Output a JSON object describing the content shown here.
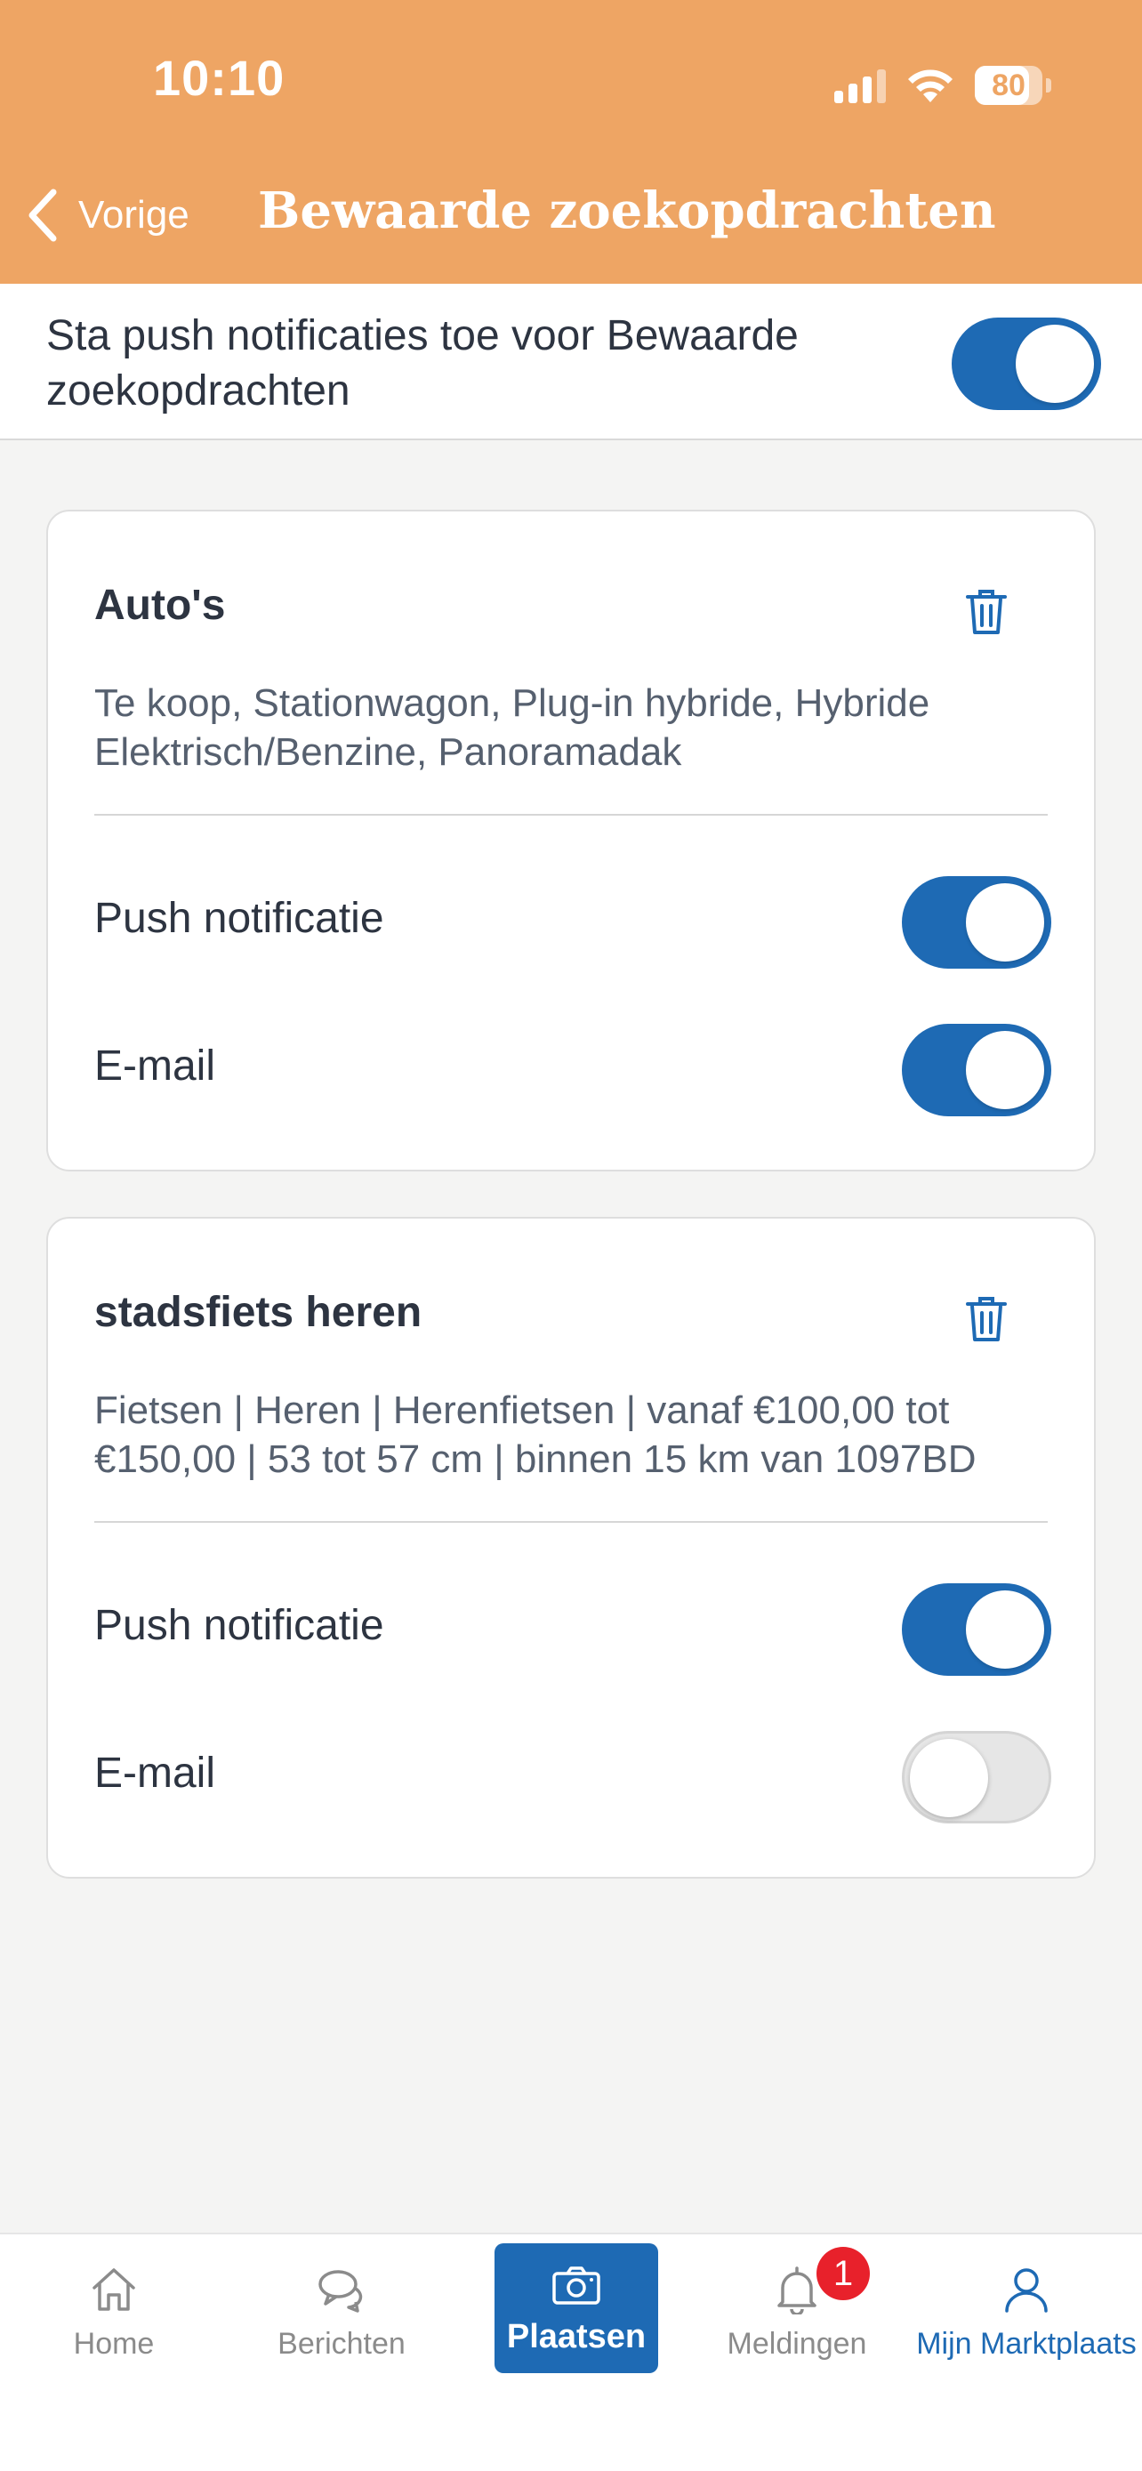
{
  "status_bar": {
    "time": "10:10",
    "battery_percent": "80",
    "icons": [
      "signal-icon",
      "wifi-icon",
      "battery-icon"
    ]
  },
  "header": {
    "back_label": "Vorige",
    "title": "Bewaarde zoekopdrachten",
    "background_color": "#eea564"
  },
  "global_notifications": {
    "label": "Sta push notificaties toe voor Bewaarde zoekopdrachten",
    "enabled": true
  },
  "saved_searches": [
    {
      "title": "Auto's",
      "description": "Te koop, Stationwagon, Plug-in hybride, Hybride Elektrisch/Benzine, Panoramadak",
      "push_label": "Push notificatie",
      "push_enabled": true,
      "email_label": "E-mail",
      "email_enabled": true
    },
    {
      "title": "stadsfiets heren",
      "description": "Fietsen | Heren | Herenfietsen | vanaf €100,00 tot €150,00 | 53 tot 57 cm | binnen 15 km van 1097BD",
      "push_label": "Push notificatie",
      "push_enabled": true,
      "email_label": "E-mail",
      "email_enabled": false
    }
  ],
  "bottom_nav": {
    "items": [
      {
        "label": "Home",
        "icon": "home-icon"
      },
      {
        "label": "Berichten",
        "icon": "chat-icon"
      },
      {
        "label": "Plaatsen",
        "icon": "camera-icon"
      },
      {
        "label": "Meldingen",
        "icon": "bell-icon",
        "badge": "1"
      },
      {
        "label": "Mijn Marktplaats",
        "icon": "user-icon",
        "active": true
      }
    ]
  },
  "colors": {
    "accent": "#1e6ab4",
    "badge": "#e8212b"
  }
}
